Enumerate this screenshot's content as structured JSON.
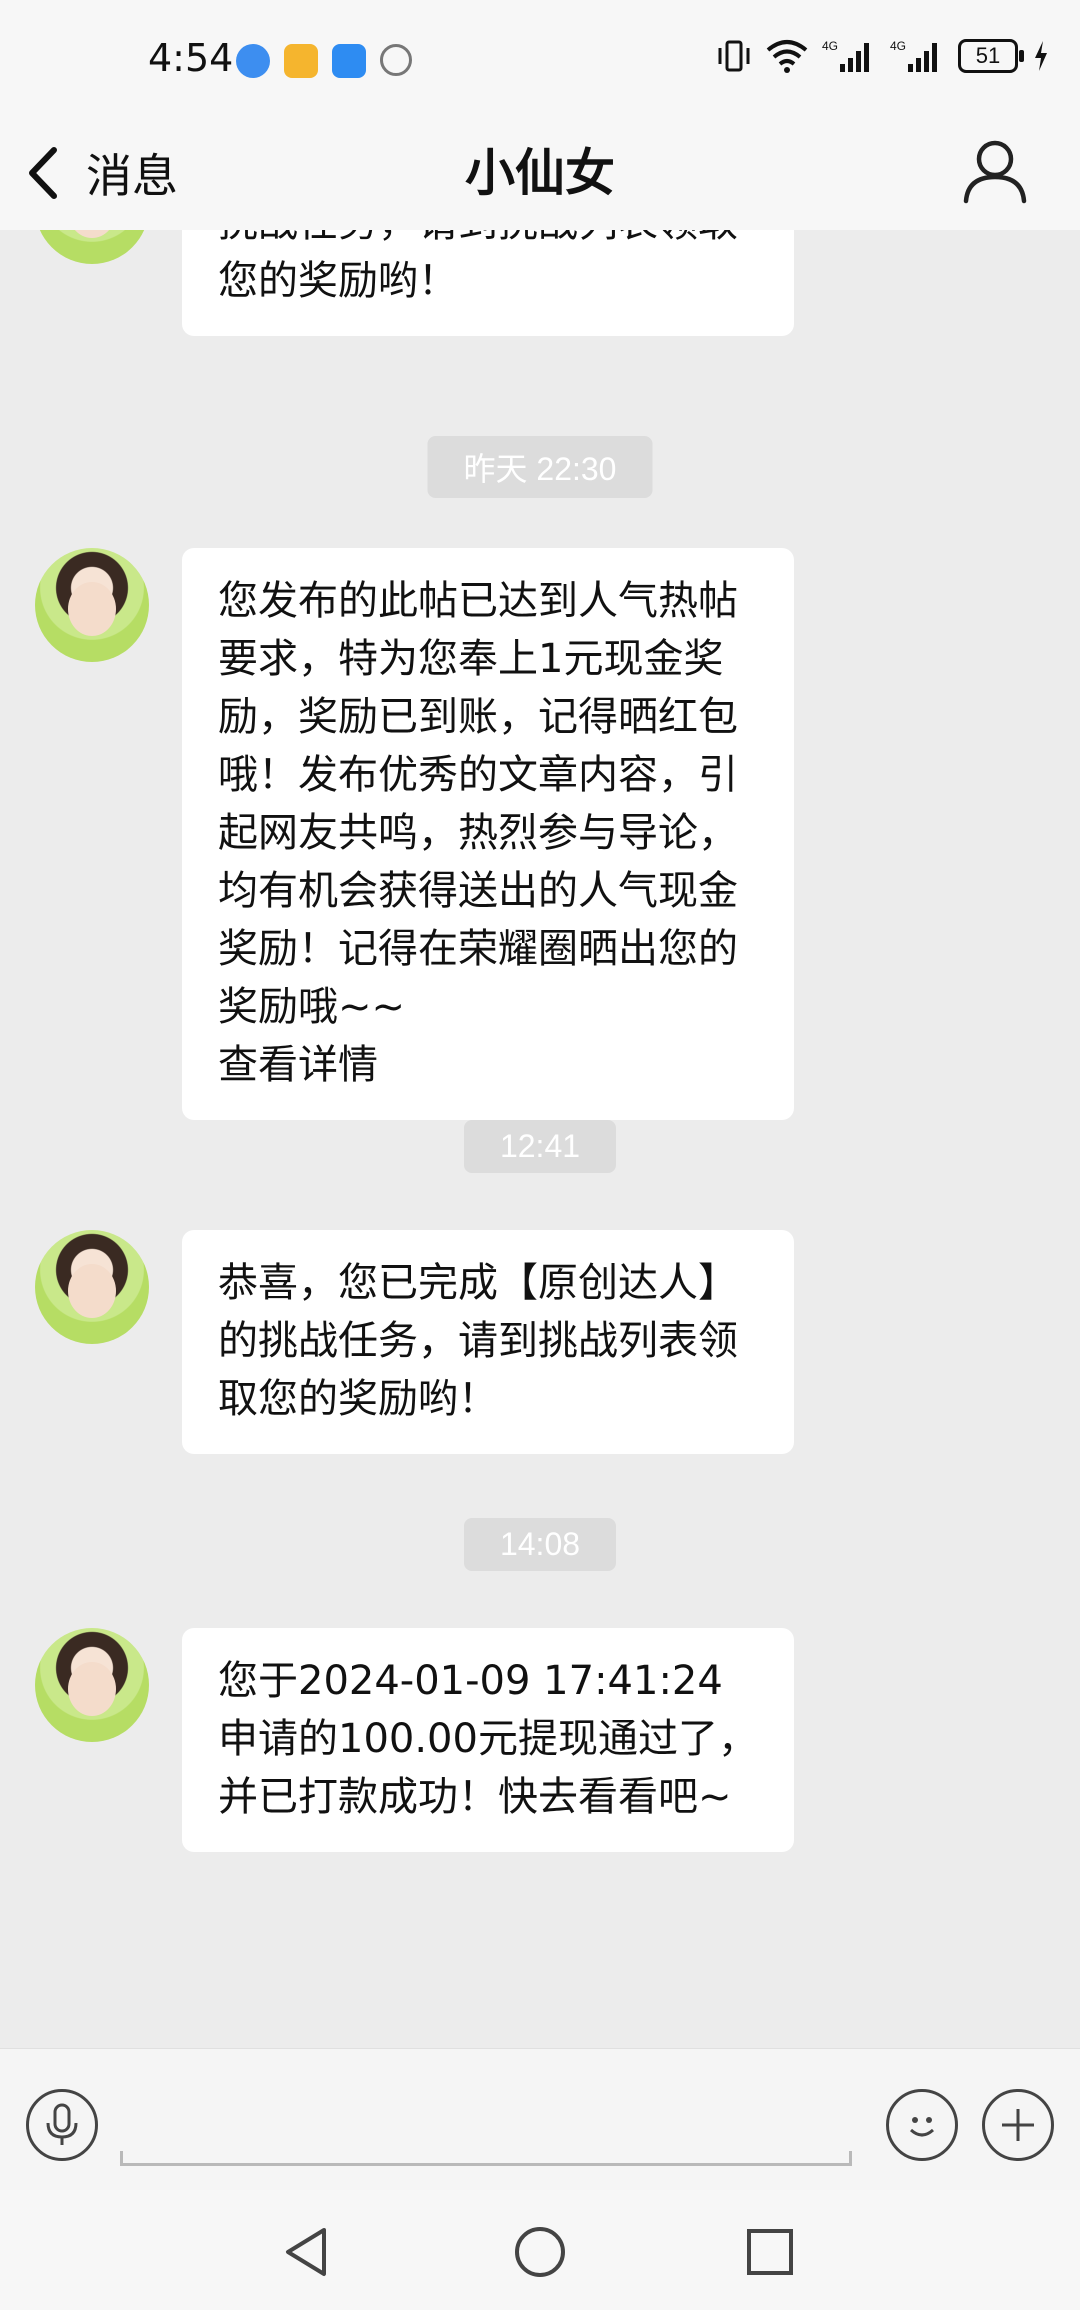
{
  "status_bar": {
    "time": "4:54",
    "battery": "51",
    "network": [
      "4G",
      "4G"
    ]
  },
  "header": {
    "back_label": "消息",
    "title": "小仙女"
  },
  "messages": [
    {
      "text": "挑战任务，请到挑战列表领取您的奖励哟！"
    },
    {
      "timestamp": "昨天 22:30",
      "text": "您发布的此帖已达到人气热帖要求，特为您奉上1元现金奖励，奖励已到账，记得晒红包哦！发布优秀的文章内容，引起网友共鸣，热烈参与导论，均有机会获得送出的人气现金奖励！记得在荣耀圈晒出您的奖励哦~~\n查看详情"
    },
    {
      "timestamp": "12:41",
      "text": "恭喜，您已完成【原创达人】的挑战任务，请到挑战列表领取您的奖励哟！"
    },
    {
      "timestamp": "14:08",
      "text": "您于2024-01-09 17:41:24申请的100.00元提现通过了，并已打款成功！快去看看吧~"
    }
  ],
  "colors": {
    "background": "#ececec",
    "bubble": "#ffffff",
    "timestamp_bg": "#dcdcdc"
  }
}
